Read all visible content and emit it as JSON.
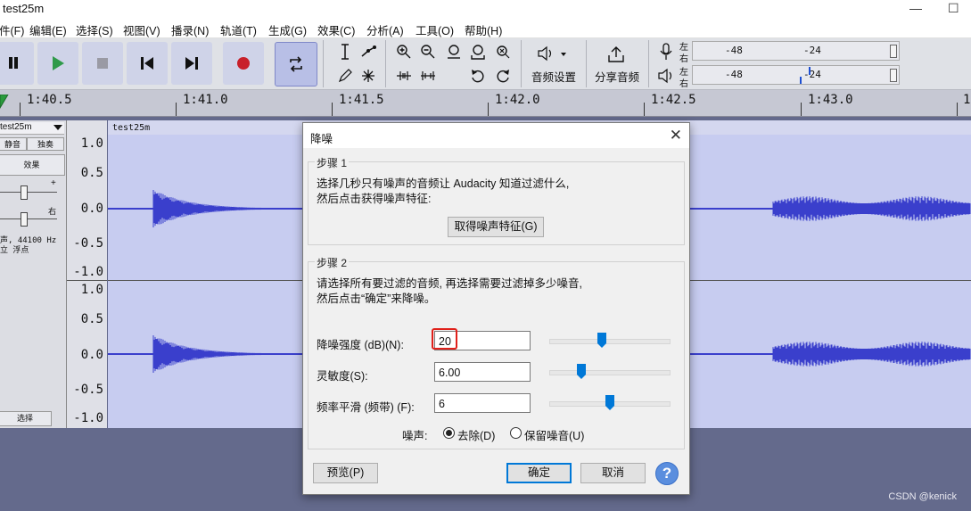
{
  "window": {
    "title": "test25m"
  },
  "menu": [
    "件(F)",
    "编辑(E)",
    "选择(S)",
    "视图(V)",
    "播录(N)",
    "轨道(T)",
    "生成(G)",
    "效果(C)",
    "分析(A)",
    "工具(O)",
    "帮助(H)"
  ],
  "toolbar": {
    "audio_setup": "音频设置",
    "share_audio": "分享音频"
  },
  "meters": {
    "record": {
      "left": "左",
      "right": "右",
      "marks": [
        "-48",
        "-24"
      ]
    },
    "playback": {
      "left": "左",
      "right": "右",
      "marks": [
        "-48",
        "-24"
      ]
    }
  },
  "timeline": {
    "ticks": [
      "1:40.5",
      "1:41.0",
      "1:41.5",
      "1:42.0",
      "1:42.5",
      "1:43.0",
      "1"
    ]
  },
  "track": {
    "name": "test25m",
    "mute": "静音",
    "solo": "独奏",
    "effects": "效果",
    "gain_plus": "+",
    "pan_right": "右",
    "info_line1": "声, 44100 Hz",
    "info_line2": "立 浮点",
    "select": "选择",
    "clip_name": "test25m",
    "scale_upper": [
      "1.0",
      "0.5",
      "0.0",
      "-0.5",
      "-1.0"
    ],
    "scale_lower": [
      "1.0",
      "0.5",
      "0.0",
      "-0.5",
      "-1.0"
    ]
  },
  "dialog": {
    "title": "降噪",
    "step1": {
      "label": "步骤 1",
      "line1": "选择几秒只有噪声的音频让 Audacity 知道过滤什么,",
      "line2": "然后点击获得噪声特征:",
      "button": "取得噪声特征(G)"
    },
    "step2": {
      "label": "步骤 2",
      "line1": "请选择所有要过滤的音频, 再选择需要过滤掉多少噪音,",
      "line2": "然后点击“确定”来降噪。",
      "noise_reduction_label": "降噪强度 (dB)(N):",
      "noise_reduction_value": "20",
      "sensitivity_label": "灵敏度(S):",
      "sensitivity_value": "6.00",
      "smoothing_label": "频率平滑 (频带) (F):",
      "smoothing_value": "6",
      "noise_label": "噪声:",
      "option_remove": "去除(D)",
      "option_residue": "保留噪音(U)",
      "slider_levels": {
        "noise_reduction": 0.44,
        "sensitivity": 0.27,
        "smoothing": 0.51
      }
    },
    "buttons": {
      "preview": "预览(P)",
      "ok": "确定",
      "cancel": "取消",
      "help": "?"
    }
  },
  "watermark": "CSDN @kenick",
  "colors": {
    "waveform": "#3a3fcc",
    "track_bg": "#c7ccf0",
    "background": "#646a8c",
    "highlight": "#e0201a",
    "accent": "#0078d7"
  }
}
